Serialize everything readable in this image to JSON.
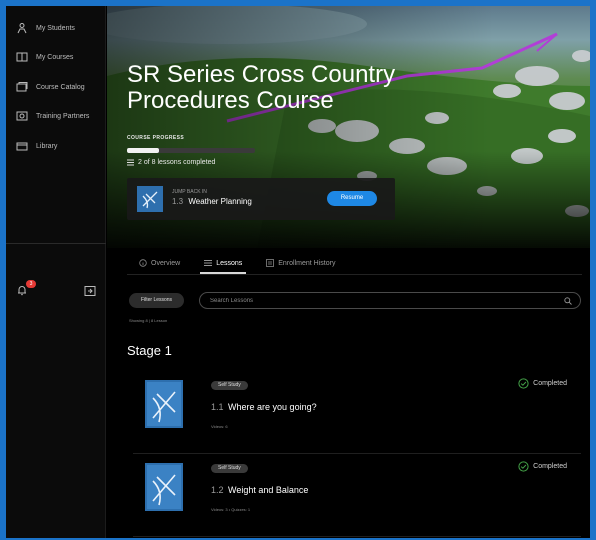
{
  "sidebar": {
    "items": [
      {
        "label": "My Students",
        "icon": "students-icon"
      },
      {
        "label": "My Courses",
        "icon": "book-icon"
      },
      {
        "label": "Course Catalog",
        "icon": "catalog-icon"
      },
      {
        "label": "Training Partners",
        "icon": "partners-icon"
      },
      {
        "label": "Library",
        "icon": "library-icon"
      }
    ],
    "notifications_count": "3"
  },
  "hero": {
    "title": "SR Series Cross Country Procedures Course",
    "progress_label": "COURSE PROGRESS",
    "progress_fraction": 0.25,
    "progress_text": "2 of 8 lessons completed",
    "jump": {
      "kicker": "JUMP BACK IN",
      "lesson_number": "1.3",
      "lesson_title": "Weather Planning",
      "resume_label": "Resume"
    }
  },
  "tabs": [
    {
      "label": "Overview",
      "active": false
    },
    {
      "label": "Lessons",
      "active": true
    },
    {
      "label": "Enrollment History",
      "active": false
    }
  ],
  "filters": {
    "filter_label": "Filter Lessons",
    "search_placeholder": "Search Lessons",
    "showing_text": "Showing 8 | 8 Lesson"
  },
  "stage": {
    "title": "Stage 1",
    "lessons": [
      {
        "tag": "Self Study",
        "number": "1.1",
        "title": "Where are you going?",
        "meta": "Videos: 6",
        "status": "Completed"
      },
      {
        "tag": "Self Study",
        "number": "1.2",
        "title": "Weight and Balance",
        "meta": "Videos: 3 • Quizzes: 1",
        "status": "Completed"
      }
    ]
  },
  "colors": {
    "accent": "#1e88e5",
    "completed": "#43a047",
    "frame": "#1b73c9"
  }
}
